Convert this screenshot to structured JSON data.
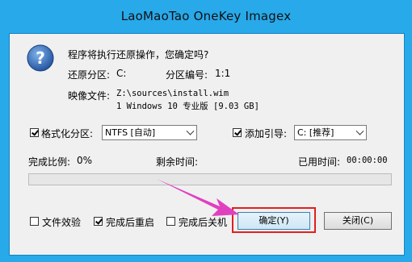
{
  "window": {
    "title": "LaoMaoTao OneKey Imagex"
  },
  "dialog": {
    "question": "程序将执行还原操作，您确定吗?",
    "partition_label": "还原分区:",
    "partition_value": "C:",
    "partition_number_label": "分区编号:",
    "partition_number_value": "1:1",
    "image_label": "映像文件:",
    "image_path": "Z:\\sources\\install.wim",
    "image_info": "1 Windows 10 专业版 [9.03 GB]"
  },
  "options": {
    "format_label": "格式化分区:",
    "format_checked": true,
    "format_select": "NTFS [自动]",
    "boot_label": "添加引导:",
    "boot_checked": true,
    "boot_select": "C: [推荐]"
  },
  "status": {
    "completion_label": "完成比例:",
    "completion_value": "0%",
    "remaining_label": "剩余时间:",
    "remaining_value": "",
    "elapsed_label": "已用时间:",
    "elapsed_value": "00:00:00",
    "progress": 0
  },
  "footer": {
    "verify_label": "文件效验",
    "verify_checked": false,
    "restart_label": "完成后重启",
    "restart_checked": true,
    "shutdown_label": "完成后关机",
    "shutdown_checked": false,
    "ok_label": "确定(Y)",
    "close_label": "关闭(C)"
  },
  "colors": {
    "accent": "#28a9ea",
    "highlight_box": "#e02020",
    "arrow": "#e040c0"
  }
}
